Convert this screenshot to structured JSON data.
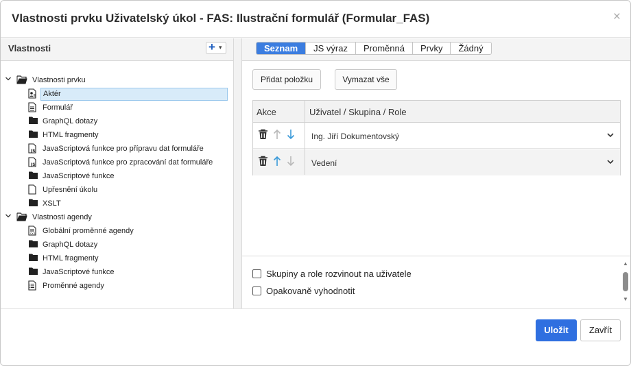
{
  "dialog": {
    "title": "Vlastnosti prvku Uživatelský úkol - FAS: Ilustrační formulář (Formular_FAS)",
    "close_glyph": "×"
  },
  "left_panel": {
    "header_label": "Vlastnosti",
    "add_button_glyph": "+",
    "add_button_caret": "▾",
    "tree": [
      {
        "label": "Vlastnosti prvku",
        "icon": "folder-open-icon",
        "level": 0,
        "expanded": true
      },
      {
        "label": "Aktér",
        "icon": "actor-document-icon",
        "level": 1,
        "selected": true
      },
      {
        "label": "Formulář",
        "icon": "form-document-icon",
        "level": 1
      },
      {
        "label": "GraphQL dotazy",
        "icon": "folder-icon",
        "level": 1
      },
      {
        "label": "HTML fragmenty",
        "icon": "folder-icon",
        "level": 1
      },
      {
        "label": "JavaScriptová funkce pro přípravu dat formuláře",
        "icon": "js-file-icon",
        "level": 1
      },
      {
        "label": "JavaScriptová funkce pro zpracování dat formuláře",
        "icon": "js-file-icon",
        "level": 1
      },
      {
        "label": "JavaScriptové funkce",
        "icon": "folder-icon",
        "level": 1
      },
      {
        "label": "Upřesnění úkolu",
        "icon": "blank-document-icon",
        "level": 1
      },
      {
        "label": "XSLT",
        "icon": "folder-icon",
        "level": 1
      },
      {
        "label": "Vlastnosti agendy",
        "icon": "folder-open-icon",
        "level": 0,
        "expanded": true
      },
      {
        "label": "Globální proměnné agendy",
        "icon": "variables-document-icon",
        "level": 1
      },
      {
        "label": "GraphQL dotazy",
        "icon": "folder-icon",
        "level": 1
      },
      {
        "label": "HTML fragmenty",
        "icon": "folder-icon",
        "level": 1
      },
      {
        "label": "JavaScriptové funkce",
        "icon": "folder-icon",
        "level": 1
      },
      {
        "label": "Proměnné agendy",
        "icon": "variables-list-icon",
        "level": 1
      }
    ]
  },
  "right_panel": {
    "tabs": [
      {
        "label": "Seznam",
        "active": true
      },
      {
        "label": "JS výraz",
        "active": false
      },
      {
        "label": "Proměnná",
        "active": false
      },
      {
        "label": "Prvky",
        "active": false
      },
      {
        "label": "Žádný",
        "active": false
      }
    ],
    "add_item_button": "Přidat položku",
    "clear_all_button": "Vymazat vše",
    "grid": {
      "columns": [
        "Akce",
        "Uživatel / Skupina / Role"
      ],
      "rows": [
        {
          "value": "Ing. Jiří Dokumentovský",
          "up_enabled": false,
          "down_enabled": true
        },
        {
          "value": "Vedení",
          "up_enabled": true,
          "down_enabled": false
        }
      ]
    },
    "checkboxes": [
      {
        "label": "Skupiny a role rozvinout na uživatele",
        "checked": false
      },
      {
        "label": "Opakovaně vyhodnotit",
        "checked": false
      }
    ],
    "scroll_up_glyph": "▲",
    "scroll_down_glyph": "▼"
  },
  "footer": {
    "save_button": "Uložit",
    "close_button": "Zavřít"
  },
  "colors": {
    "accent": "#3b7de0",
    "primary_button": "#2f6fe0",
    "arrow_enabled": "#3a9ad9",
    "arrow_disabled": "#b9b9b9",
    "selection": "#d8ebf9"
  }
}
